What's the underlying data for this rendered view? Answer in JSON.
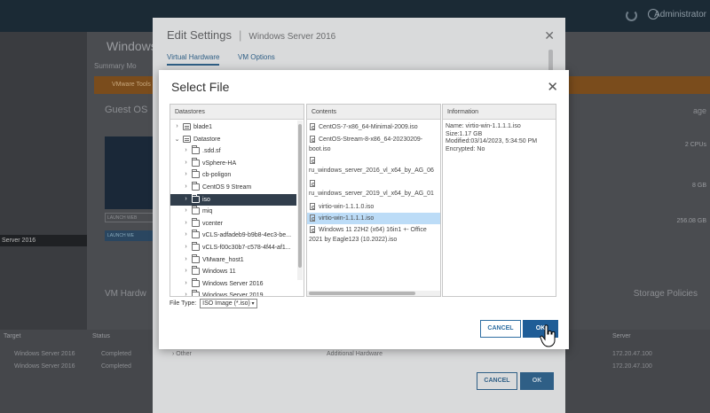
{
  "background": {
    "topbar_user": "Administrator",
    "vm_title": "Windows",
    "tabs": "Summary   Mo",
    "warning_text": "VMware Tools",
    "guest_os_label": "Guest OS",
    "launch_console": "LAUNCH WEB",
    "launch_remote": "LAUNCH WE",
    "storage_label": "age",
    "cpus": "2 CPUs",
    "memory": "8 GB",
    "disk": "256.08 GB",
    "vm_hardware_label": "VM Hardw",
    "storage_policies_label": "Storage Policies",
    "tree_selected": "Server 2016",
    "table_headers": [
      "Target",
      "Status",
      "Server"
    ],
    "table_rows": [
      {
        "target": "Windows Server 2016",
        "status": "Completed",
        "server": "172.20.47.100"
      },
      {
        "target": "Windows Server 2016",
        "status": "Completed",
        "server": "172.20.47.100"
      }
    ]
  },
  "edit_settings": {
    "title": "Edit Settings",
    "subtitle": "Windows Server 2016",
    "tabs": [
      {
        "label": "Virtual Hardware",
        "active": true
      },
      {
        "label": "VM Options",
        "active": false
      }
    ],
    "row_other": "Other",
    "row_additional": "Additional Hardware",
    "cancel_label": "CANCEL",
    "ok_label": "OK"
  },
  "select_file": {
    "title": "Select File",
    "headers": {
      "datastores": "Datastores",
      "contents": "Contents",
      "information": "Information"
    },
    "tree": [
      {
        "label": "blade1",
        "icon": "db",
        "level": 0,
        "expanded": false
      },
      {
        "label": "Datastore",
        "icon": "db",
        "level": 0,
        "expanded": true
      },
      {
        "label": ".sdd.sf",
        "icon": "folder",
        "level": 1,
        "expanded": false
      },
      {
        "label": "vSphere-HA",
        "icon": "folder",
        "level": 1,
        "expanded": false
      },
      {
        "label": "cb-poligon",
        "icon": "folder",
        "level": 1,
        "expanded": false
      },
      {
        "label": "CentOS 9 Stream",
        "icon": "folder",
        "level": 1,
        "expanded": false
      },
      {
        "label": "iso",
        "icon": "folder",
        "level": 1,
        "expanded": false,
        "selected": true
      },
      {
        "label": "miq",
        "icon": "folder",
        "level": 1,
        "expanded": false
      },
      {
        "label": "vcenter",
        "icon": "folder",
        "level": 1,
        "expanded": false
      },
      {
        "label": "vCLS-adfadeb9-b9b8-4ec3-be...",
        "icon": "folder",
        "level": 1,
        "expanded": false
      },
      {
        "label": "vCLS-f00c30b7-c578-4f44-af1...",
        "icon": "folder",
        "level": 1,
        "expanded": false
      },
      {
        "label": "VMware_host1",
        "icon": "folder",
        "level": 1,
        "expanded": false
      },
      {
        "label": "Windows 11",
        "icon": "folder",
        "level": 1,
        "expanded": false
      },
      {
        "label": "Windows Server 2016",
        "icon": "folder",
        "level": 1,
        "expanded": false
      },
      {
        "label": "Windows Server 2019",
        "icon": "folder",
        "level": 1,
        "expanded": false
      }
    ],
    "contents": [
      {
        "line1": "CentOS-7-x86_64-Minimal-2009.iso",
        "line2": ""
      },
      {
        "line1": "CentOS-Stream-8-x86_64-20230209-",
        "line2": "boot.iso"
      },
      {
        "line1": "",
        "line2": "ru_windows_server_2016_vl_x64_by_AG_06"
      },
      {
        "line1": "",
        "line2": "ru_windows_server_2019_vl_x64_by_AG_01"
      },
      {
        "line1": "virtio-win-1.1.1.0.iso",
        "line2": ""
      },
      {
        "line1": "virtio-win-1.1.1.1.iso",
        "line2": "",
        "selected": true
      },
      {
        "line1": "Windows 11 22H2 (x64) 16in1 +- Office",
        "line2": "2021 by Eagle123 (10.2022).iso"
      }
    ],
    "information": {
      "name": "Name: virtio-win-1.1.1.1.iso",
      "size": "Size:1.17 GB",
      "modified": "Modified:03/14/2023, 5:34:50 PM",
      "encrypted": "Encrypted: No"
    },
    "file_type_label": "File Type:",
    "file_type_value": "ISO Image (*.iso)",
    "cancel_label": "CANCEL",
    "ok_label": "OK"
  }
}
